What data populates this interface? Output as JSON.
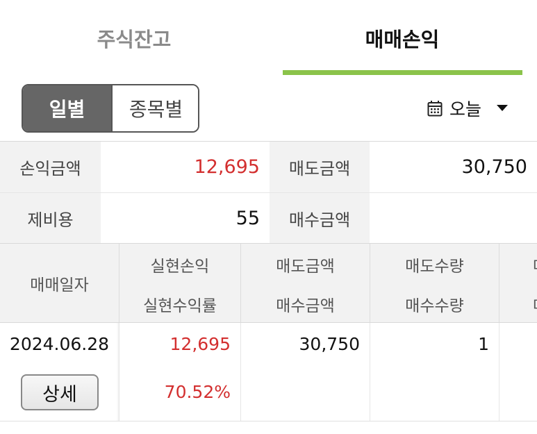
{
  "tabs": {
    "stock_balance": "주식잔고",
    "trade_pl": "매매손익",
    "active": "trade_pl"
  },
  "segmented": {
    "daily": "일별",
    "by_stock": "종목별",
    "selected": "daily"
  },
  "date_filter": {
    "label": "오늘",
    "icon": "calendar-icon"
  },
  "summary": {
    "pl_amount_label": "손익금액",
    "pl_amount_value": "12,695",
    "sell_amount_label": "매도금액",
    "sell_amount_value": "30,750",
    "fees_label": "제비용",
    "fees_value": "55",
    "buy_amount_label": "매수금액",
    "buy_amount_value": ""
  },
  "table": {
    "headers": {
      "trade_date": "매매일자",
      "realized_pl": "실현손익",
      "realized_rate": "실현수익률",
      "sell_amount": "매도금액",
      "buy_amount": "매수금액",
      "sell_qty": "매도수량",
      "buy_qty": "매수수량",
      "more_top": "매",
      "more_bottom": "매"
    },
    "rows": [
      {
        "trade_date": "2024.06.28",
        "detail_label": "상세",
        "realized_pl": "12,695",
        "realized_rate": "70.52%",
        "sell_amount": "30,750",
        "buy_amount": "",
        "sell_qty": "1",
        "buy_qty": ""
      }
    ]
  },
  "colors": {
    "accent_green": "#8bc34a",
    "profit_red": "#d32f2f",
    "segment_selected": "#666666"
  }
}
